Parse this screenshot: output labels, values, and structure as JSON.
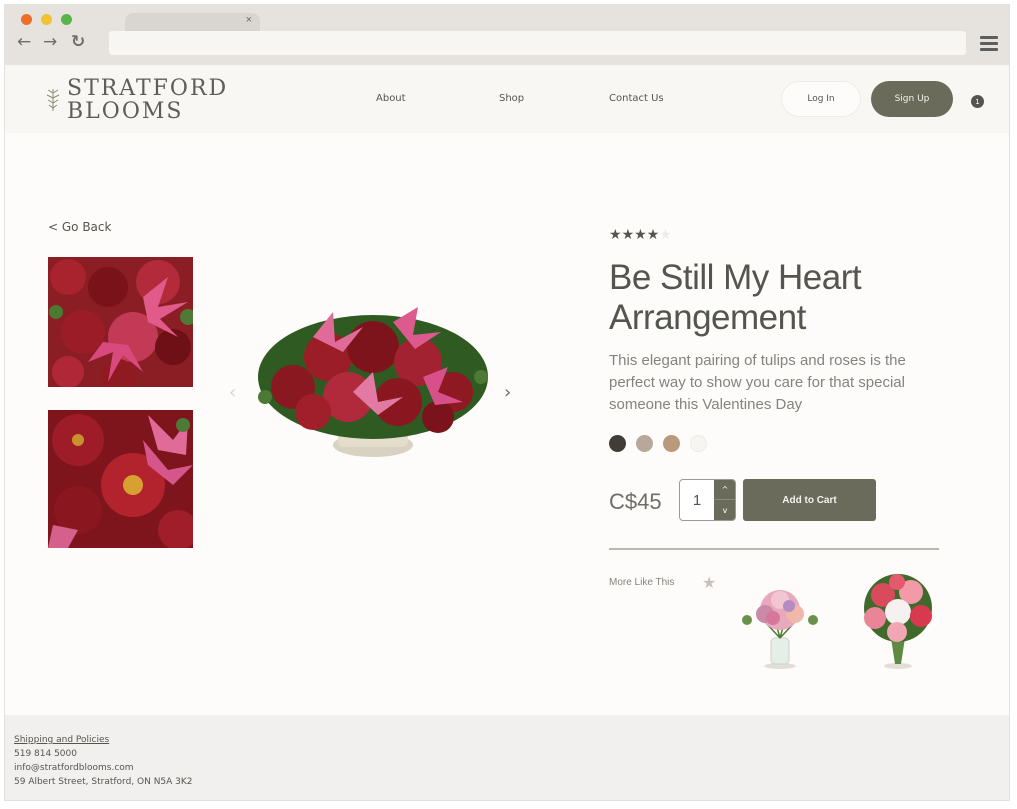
{
  "browser": {
    "tab_close": "×",
    "back_glyph": "←",
    "forward_glyph": "→",
    "reload_glyph": "↻",
    "traffic_colors": [
      "#ec6f2b",
      "#f1c232",
      "#5ab44a"
    ]
  },
  "header": {
    "logo_line1": "STRATFORD",
    "logo_line2": "BLOOMS",
    "nav": [
      "About",
      "Shop",
      "Contact Us"
    ],
    "login_label": "Log In",
    "signup_label": "Sign Up",
    "cart_count": "1"
  },
  "product": {
    "go_back": "< Go Back",
    "rating": 4,
    "rating_max": 5,
    "title": "Be Still My Heart Arrangement",
    "description": "This elegant pairing of tulips and roses is the perfect way to show you care for that special someone this Valentines Day",
    "swatches": [
      "#403c38",
      "#b8a89a",
      "#b99a7a",
      "#f7f5f1"
    ],
    "price": "C$45",
    "quantity": "1",
    "qty_up": "^",
    "qty_down": "v",
    "add_to_cart": "Add to Cart",
    "prev_arrow": "‹",
    "next_arrow": "›"
  },
  "recommendations": {
    "heading": "More Like This"
  },
  "footer": {
    "shipping": "Shipping and Policies",
    "phone": "519 814 5000",
    "email": "info@stratfordblooms.com",
    "address": "59 Albert Street, Stratford, ON  N5A 3K2"
  },
  "colors": {
    "accent": "#6a6b5b",
    "text": "#55554f",
    "star_on": "#55554f",
    "star_off": "#eeebe8"
  }
}
